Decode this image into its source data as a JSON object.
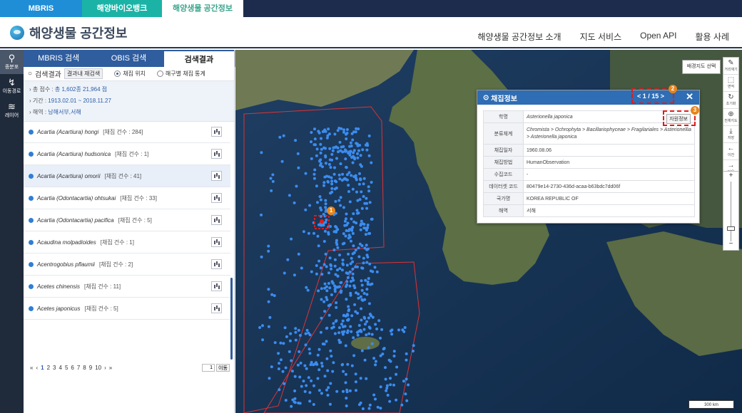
{
  "top_tabs": [
    "MBRIS",
    "해양바이오뱅크",
    "해양생물 공간정보"
  ],
  "logo_text": "해양생물 공간정보",
  "main_nav": [
    "해양생물 공간정보 소개",
    "지도 서비스",
    "Open API",
    "활용 사례"
  ],
  "icon_bar": [
    {
      "label": "종분포",
      "icon": "map-pin-icon"
    },
    {
      "label": "이동경로",
      "icon": "route-icon"
    },
    {
      "label": "레이어",
      "icon": "layers-icon"
    }
  ],
  "panel": {
    "tabs": [
      "MBRIS 검색",
      "OBIS 검색",
      "검색결과"
    ],
    "results_label": "검색결과",
    "filter_button": "결과내 재검색",
    "radio_1": "채집 위치",
    "radio_2": "해구별 채집 통계",
    "summary": {
      "total_label": "총 점수 :",
      "total_value": "총 1,602종 21,964 점",
      "period_label": "기간 :",
      "period_value": "1913.02.01 ~ 2018.11.27",
      "sea_label": "해역 :",
      "sea_value": "남해서부,서해"
    },
    "items": [
      {
        "name": "Acartia (Acartiura) hongi",
        "count": "[채집 건수 : 284]"
      },
      {
        "name": "Acartia (Acartiura) hudsonica",
        "count": "[채집 건수 : 1]"
      },
      {
        "name": "Acartia (Acartiura) omorii",
        "count": "[채집 건수 : 41]"
      },
      {
        "name": "Acartia (Odontacartia) ohtsukai",
        "count": "[채집 건수 : 33]"
      },
      {
        "name": "Acartia (Odontacartia) pacifica",
        "count": "[채집 건수 : 5]"
      },
      {
        "name": "Acaudina molpadioides",
        "count": "[채집 건수 : 1]"
      },
      {
        "name": "Acentrogobius pflaumii",
        "count": "[채집 건수 : 2]"
      },
      {
        "name": "Acetes chinensis",
        "count": "[채집 건수 : 11]"
      },
      {
        "name": "Acetes japonicus",
        "count": "[채집 건수 : 5]"
      }
    ],
    "pager": {
      "first": "«",
      "prev": "‹",
      "pages": [
        "1",
        "2",
        "3",
        "4",
        "5",
        "6",
        "7",
        "8",
        "9",
        "10"
      ],
      "next": "›",
      "last": "»",
      "go_value": "1",
      "go_label": "이동"
    }
  },
  "map": {
    "basemap_button": "배경지도 선택",
    "tools": [
      {
        "label": "거리재기",
        "icon": "pencil-icon"
      },
      {
        "label": "면적",
        "icon": "area-icon"
      },
      {
        "label": "초기화",
        "icon": "refresh-icon"
      },
      {
        "label": "전체지도",
        "icon": "globe-icon"
      },
      {
        "label": "저장",
        "icon": "save-icon"
      },
      {
        "label": "이전",
        "icon": "arrow-left-icon"
      },
      {
        "label": "다음",
        "icon": "arrow-right-icon"
      }
    ],
    "zoom_in": "+",
    "zoom_out": "−",
    "scale": "300 km"
  },
  "popup": {
    "title": "채집정보",
    "nav": "< 1 / 15 >",
    "resource_button": "자원정보",
    "rows": [
      {
        "key": "학명",
        "value": "Asterionella japonica"
      },
      {
        "key": "분류체계",
        "value": "Chromista > Ochrophyta > Bacillariophyceae > Fragilariales > Asterionellia > Asterionella japonica"
      },
      {
        "key": "채집일자",
        "value": "1960.08.06"
      },
      {
        "key": "채집방법",
        "value": "HumanObservation"
      },
      {
        "key": "수집코드",
        "value": "-"
      },
      {
        "key": "데이터셋 코드",
        "value": "80479e14-2730-436d-acaa-b63bdc7dd06f"
      },
      {
        "key": "국가명",
        "value": "KOREA REPUBLIC OF"
      },
      {
        "key": "해역",
        "value": "서해"
      }
    ]
  },
  "annotations": [
    "1",
    "2",
    "3"
  ]
}
